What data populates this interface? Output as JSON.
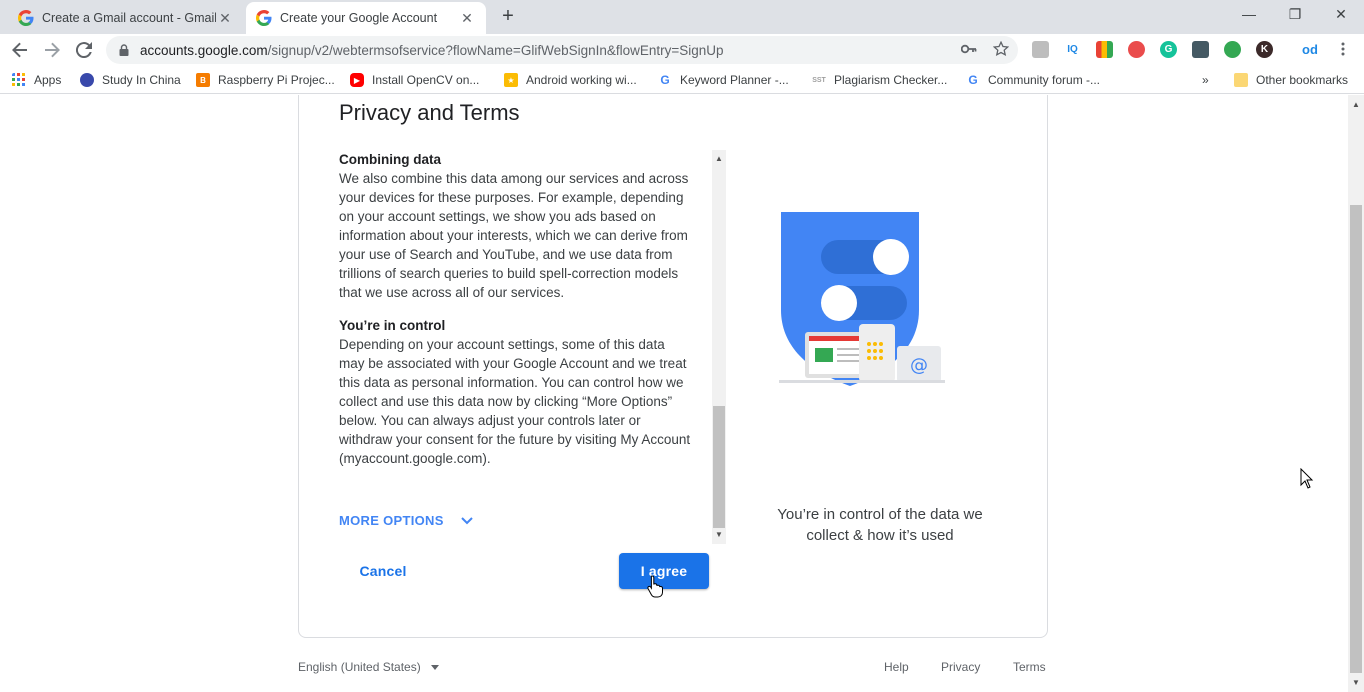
{
  "browser": {
    "tabs": [
      {
        "title": "Create a Gmail account - Gmail H",
        "active": false
      },
      {
        "title": "Create your Google Account",
        "active": true
      }
    ],
    "new_tab": "+",
    "window_controls": {
      "minimize": "—",
      "restore": "❐",
      "close": "✕"
    },
    "url": {
      "domain": "accounts.google.com",
      "path": "/signup/v2/webtermsofservice?flowName=GlifWebSignIn&flowEntry=SignUp"
    },
    "extensions": [
      {
        "label": "",
        "color": "#9e9e9e"
      },
      {
        "label": "IQ",
        "color": "#ffffff"
      },
      {
        "label": "",
        "color": "#e94235"
      },
      {
        "label": "",
        "color": "#ea4c4c"
      },
      {
        "label": "G",
        "color": "#15c39a"
      },
      {
        "label": "",
        "color": "#455a64"
      },
      {
        "label": "",
        "color": "#34a853"
      },
      {
        "label": "K",
        "color": "#3c2a2a"
      },
      {
        "label": "od",
        "color": "#ffffff"
      }
    ],
    "bookmarks": [
      {
        "label": "Apps",
        "color": "#4285f4"
      },
      {
        "label": "Study In China",
        "color": "#3949ab"
      },
      {
        "label": "Raspberry Pi Projec...",
        "color": "#f57c00"
      },
      {
        "label": "Install OpenCV on...",
        "color": "#ff0000"
      },
      {
        "label": "Android working wi...",
        "color": "#fbbc04"
      },
      {
        "label": "Keyword Planner -...",
        "color": "#4285f4"
      },
      {
        "label": "Plagiarism Checker...",
        "color": "#9e9e9e"
      },
      {
        "label": "Community forum -...",
        "color": "#4285f4"
      }
    ],
    "bookmarks_overflow": "»",
    "other_bookmarks": "Other bookmarks",
    "sst_label": "SST"
  },
  "page": {
    "title": "Privacy and Terms",
    "sections": [
      {
        "heading": "Combining data",
        "body": "We also combine this data among our services and across your devices for these purposes. For example, depending on your account settings, we show you ads based on information about your interests, which we can derive from your use of Search and YouTube, and we use data from trillions of search queries to build spell-correction models that we use across all of our services."
      },
      {
        "heading": "You’re in control",
        "body": "Depending on your account settings, some of this data may be associated with your Google Account and we treat this data as personal information. You can control how we collect and use this data now by clicking “More Options” below. You can always adjust your controls later or withdraw your consent for the future by visiting My Account (myaccount.google.com)."
      }
    ],
    "more_options": "MORE OPTIONS",
    "cancel": "Cancel",
    "agree": "I agree",
    "caption": "You’re in control of the data we collect & how it’s used",
    "at_sign": "@",
    "colors": {
      "accent": "#1a73e8",
      "shield": "#4285f4",
      "link": "#4285f4"
    }
  },
  "footer": {
    "language": "English (United States)",
    "links": [
      "Help",
      "Privacy",
      "Terms"
    ]
  }
}
